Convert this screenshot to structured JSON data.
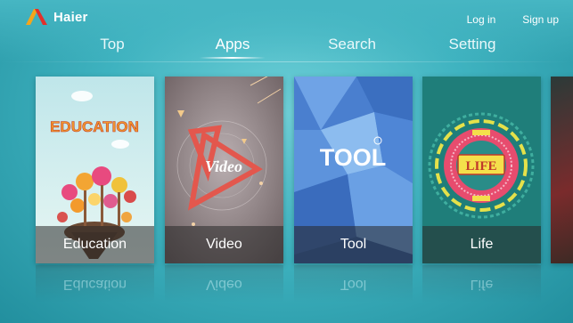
{
  "brand": {
    "name": "Haier"
  },
  "account": {
    "login": "Log in",
    "signup": "Sign up"
  },
  "nav": {
    "tabs": [
      {
        "label": "Top",
        "active": false
      },
      {
        "label": "Apps",
        "active": true
      },
      {
        "label": "Search",
        "active": false
      },
      {
        "label": "Setting",
        "active": false
      }
    ]
  },
  "cards": [
    {
      "label": "Education",
      "art_text": "EDUCATION"
    },
    {
      "label": "Video",
      "art_text": "Video"
    },
    {
      "label": "Tool",
      "art_text": "TOOL"
    },
    {
      "label": "Life",
      "art_text": "LIFE"
    }
  ],
  "colors": {
    "background": "#3fb3c0",
    "text": "#ffffff",
    "label_bar": "#3a3a3a"
  }
}
